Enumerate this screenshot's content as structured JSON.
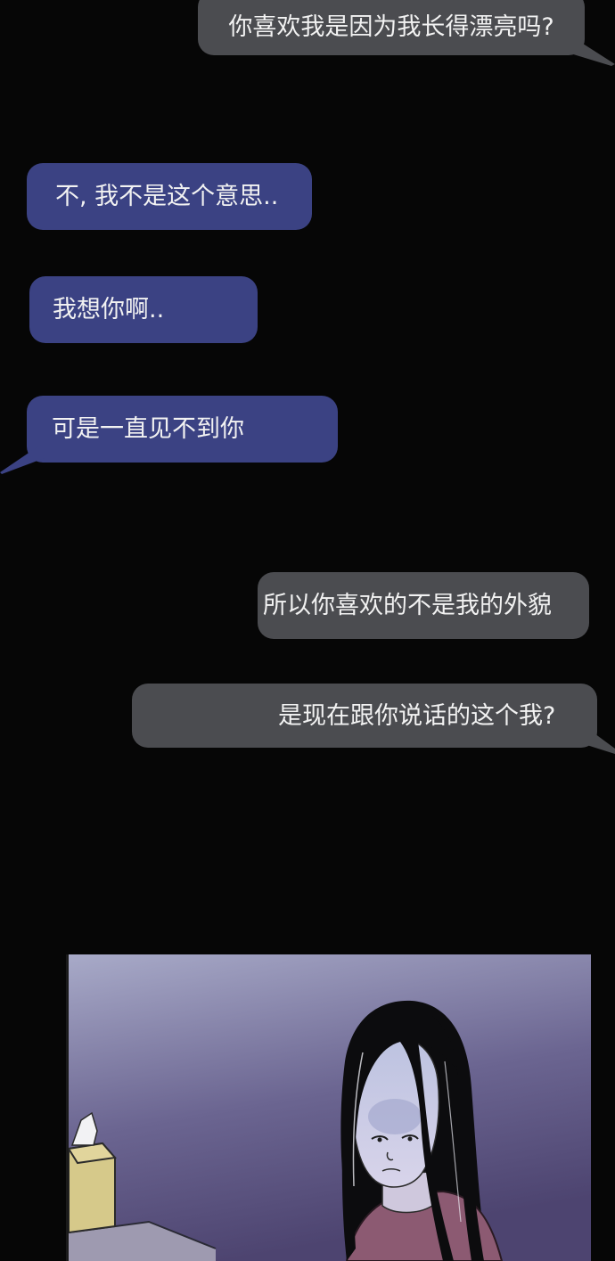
{
  "messages": [
    {
      "text": "你喜欢我是因为我长得漂亮吗?",
      "side": "right",
      "color": "gray"
    },
    {
      "text": "不, 我不是这个意思..",
      "side": "left",
      "color": "blue"
    },
    {
      "text": "我想你啊..",
      "side": "left",
      "color": "blue"
    },
    {
      "text": "可是一直见不到你",
      "side": "left",
      "color": "blue"
    },
    {
      "text": "所以你喜欢的不是我的外貌",
      "side": "right",
      "color": "gray"
    },
    {
      "text": "是现在跟你说话的这个我?",
      "side": "right",
      "color": "gray"
    }
  ],
  "colors": {
    "background": "#060606",
    "gray_bubble": "#4b4c50",
    "blue_bubble": "#3b4283",
    "bubble_text": "#f2f2f2"
  }
}
